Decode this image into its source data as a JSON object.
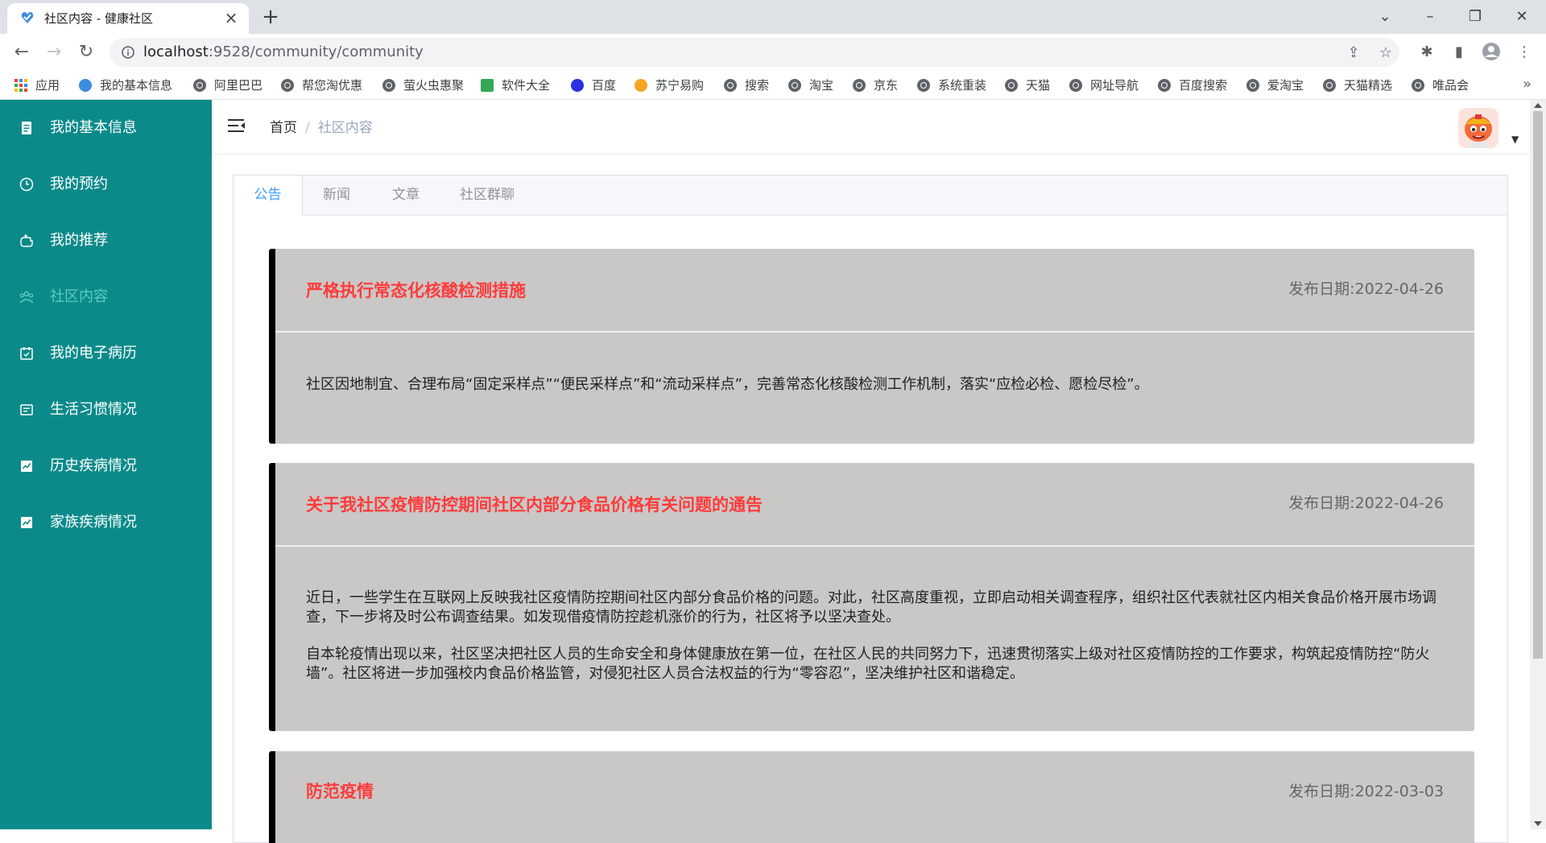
{
  "browser": {
    "tab_title": "社区内容 - 健康社区",
    "url_host": "localhost",
    "url_rest": ":9528/community/community",
    "bookmarks": [
      "应用",
      "我的基本信息",
      "阿里巴巴",
      "帮您淘优惠",
      "萤火虫惠聚",
      "软件大全",
      "百度",
      "苏宁易购",
      "搜索",
      "淘宝",
      "京东",
      "系统重装",
      "天猫",
      "网址导航",
      "百度搜索",
      "爱淘宝",
      "天猫精选",
      "唯品会"
    ]
  },
  "sidebar": {
    "bg_color": "#0c8a8a",
    "items": [
      {
        "label": "我的基本信息",
        "icon": "document-icon"
      },
      {
        "label": "我的预约",
        "icon": "clock-icon"
      },
      {
        "label": "我的推荐",
        "icon": "hand-icon"
      },
      {
        "label": "社区内容",
        "icon": "community-icon",
        "active": true
      },
      {
        "label": "我的电子病历",
        "icon": "calendar-icon"
      },
      {
        "label": "生活习惯情况",
        "icon": "notes-icon"
      },
      {
        "label": "历史疾病情况",
        "icon": "chart-icon"
      },
      {
        "label": "家族疾病情况",
        "icon": "chart-icon"
      }
    ]
  },
  "header": {
    "breadcrumb": {
      "home": "首页",
      "separator": "/",
      "current": "社区内容"
    }
  },
  "tabs": [
    {
      "label": "公告",
      "active": true
    },
    {
      "label": "新闻"
    },
    {
      "label": "文章"
    },
    {
      "label": "社区群聊"
    }
  ],
  "notices": [
    {
      "title": "严格执行常态化核酸检测措施",
      "date": "发布日期:2022-04-26",
      "paragraphs": [
        "社区因地制宜、合理布局“固定采样点”“便民采样点”和“流动采样点”，完善常态化核酸检测工作机制，落实“应检必检、愿检尽检”。"
      ]
    },
    {
      "title": "关于我社区疫情防控期间社区内部分食品价格有关问题的通告",
      "date": "发布日期:2022-04-26",
      "paragraphs": [
        "近日，一些学生在互联网上反映我社区疫情防控期间社区内部分食品价格的问题。对此，社区高度重视，立即启动相关调查程序，组织社区代表就社区内相关食品价格开展市场调查，下一步将及时公布调查结果。如发现借疫情防控趁机涨价的行为，社区将予以坚决查处。",
        "自本轮疫情出现以来，社区坚决把社区人员的生命安全和身体健康放在第一位，在社区人民的共同努力下，迅速贯彻落实上级对社区疫情防控的工作要求，构筑起疫情防控“防火墙”。社区将进一步加强校内食品价格监管，对侵犯社区人员合法权益的行为“零容忍”，坚决维护社区和谐稳定。"
      ]
    },
    {
      "title": "防范疫情",
      "date": "发布日期:2022-03-03",
      "paragraphs": []
    }
  ],
  "colors": {
    "notice_title": "#ff3b3b",
    "tab_active": "#409eff",
    "notice_bg": "#cac7c7"
  }
}
